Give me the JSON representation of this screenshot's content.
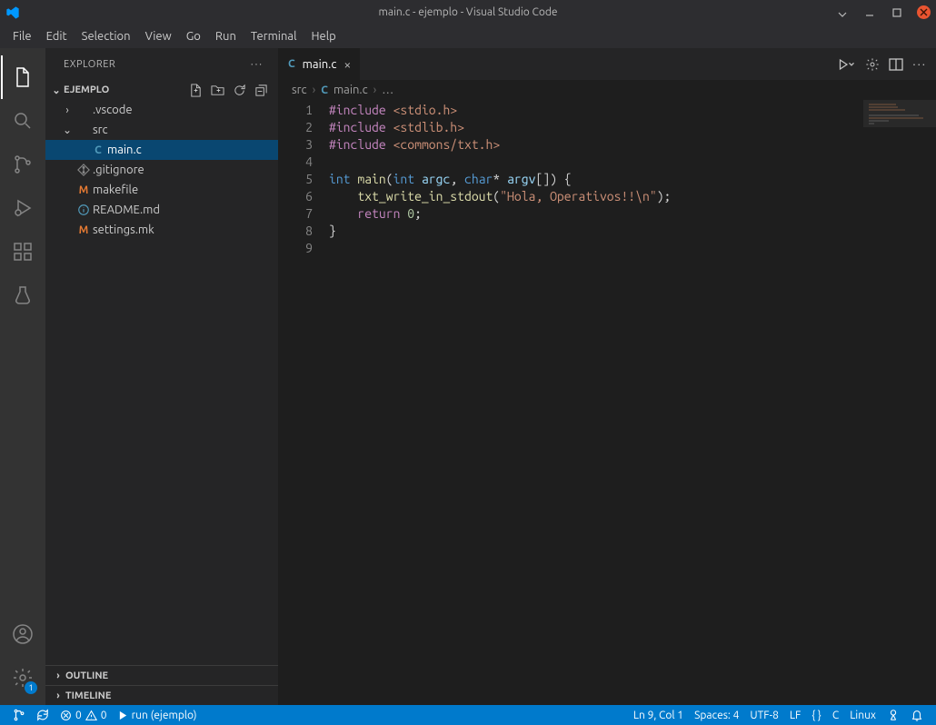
{
  "window": {
    "title": "main.c - ejemplo - Visual Studio Code"
  },
  "menubar": [
    "File",
    "Edit",
    "Selection",
    "View",
    "Go",
    "Run",
    "Terminal",
    "Help"
  ],
  "activity": {
    "badge_count": 1
  },
  "sidebar": {
    "title": "EXPLORER",
    "project": "EJEMPLO",
    "tree": [
      {
        "type": "folder",
        "name": ".vscode",
        "open": false,
        "depth": 1
      },
      {
        "type": "folder",
        "name": "src",
        "open": true,
        "depth": 1
      },
      {
        "type": "file",
        "name": "main.c",
        "icon": "c",
        "depth": 2,
        "selected": true
      },
      {
        "type": "file",
        "name": ".gitignore",
        "icon": "git",
        "depth": 1
      },
      {
        "type": "file",
        "name": "makefile",
        "icon": "m",
        "depth": 1
      },
      {
        "type": "file",
        "name": "README.md",
        "icon": "info",
        "depth": 1
      },
      {
        "type": "file",
        "name": "settings.mk",
        "icon": "m",
        "depth": 1
      }
    ],
    "panels": [
      "OUTLINE",
      "TIMELINE"
    ]
  },
  "tabs": [
    {
      "label": "main.c",
      "icon": "c",
      "active": true
    }
  ],
  "breadcrumbs": [
    "src",
    "main.c",
    "…"
  ],
  "editor": {
    "lines": [
      [
        {
          "c": "kw",
          "t": "#include"
        },
        {
          "c": "pc",
          "t": " "
        },
        {
          "c": "st",
          "t": "<stdio.h>"
        }
      ],
      [
        {
          "c": "kw",
          "t": "#include"
        },
        {
          "c": "pc",
          "t": " "
        },
        {
          "c": "st",
          "t": "<stdlib.h>"
        }
      ],
      [
        {
          "c": "kw",
          "t": "#include"
        },
        {
          "c": "pc",
          "t": " "
        },
        {
          "c": "st",
          "t": "<commons/txt.h>"
        }
      ],
      [],
      [
        {
          "c": "ty",
          "t": "int"
        },
        {
          "c": "pc",
          "t": " "
        },
        {
          "c": "fn",
          "t": "main"
        },
        {
          "c": "pc",
          "t": "("
        },
        {
          "c": "ty",
          "t": "int"
        },
        {
          "c": "pc",
          "t": " "
        },
        {
          "c": "va",
          "t": "argc"
        },
        {
          "c": "pc",
          "t": ", "
        },
        {
          "c": "ty",
          "t": "char"
        },
        {
          "c": "pc",
          "t": "* "
        },
        {
          "c": "va",
          "t": "argv"
        },
        {
          "c": "pc",
          "t": "["
        },
        {
          "c": "pc",
          "t": "]"
        },
        {
          "c": "pc",
          "t": ") {"
        }
      ],
      [
        {
          "c": "pc",
          "t": "    "
        },
        {
          "c": "fn",
          "t": "txt_write_in_stdout"
        },
        {
          "c": "pc",
          "t": "("
        },
        {
          "c": "st",
          "t": "\"Hola, Operativos!!\\n\""
        },
        {
          "c": "pc",
          "t": ");"
        }
      ],
      [
        {
          "c": "pc",
          "t": "    "
        },
        {
          "c": "kw",
          "t": "return"
        },
        {
          "c": "pc",
          "t": " "
        },
        {
          "c": "nm",
          "t": "0"
        },
        {
          "c": "pc",
          "t": ";"
        }
      ],
      [
        {
          "c": "pc",
          "t": "}"
        }
      ],
      []
    ]
  },
  "statusbar": {
    "errors": 0,
    "warnings": 0,
    "run_label": "run (ejemplo)",
    "cursor": "Ln 9, Col 1",
    "spaces": "Spaces: 4",
    "encoding": "UTF-8",
    "eol": "LF",
    "lang": "C",
    "os": "Linux",
    "lang_braces": "{ }"
  }
}
